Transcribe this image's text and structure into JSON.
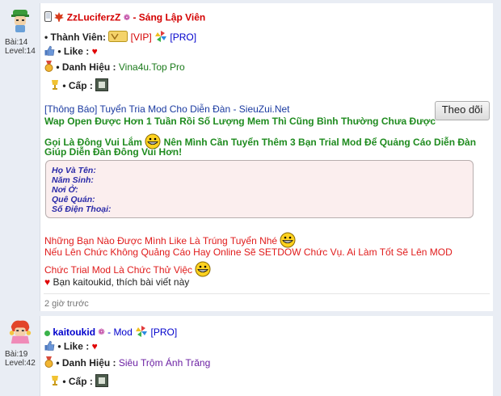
{
  "post1": {
    "username": "ZzLuciferzZ",
    "role": "Sáng Lập Viên",
    "posts_label": "Bài:14",
    "level_label": "Level:14",
    "member_label": "• Thành Viên:",
    "vip_label": "[VIP]",
    "pro_label": "[PRO]",
    "like_label": "• Like :",
    "title_label": "• Danh Hiệu :",
    "title_value": "Vina4u.Top Pro",
    "rank_label": "• Cấp :",
    "follow_button": "Theo dõi",
    "news_link": "[Thông Báo] Tuyển Tria Mod Cho Diễn Đàn - SieuZui.Net",
    "green_line1": "Wap Open Được Hơn 1 Tuần Rồi Số Lượng Mem Thì Cũng Bình Thường Chưa Được",
    "green_line2a": "Gọi Là Đông Vui Lắm",
    "green_line2b": "Nên Mình Cần Tuyển Thêm 3 Bạn Trial Mod Để Quảng Cáo Diễn Đàn",
    "green_line3": "Giúp Diễn Đàn Đông Vui Hơn!",
    "form_fields": [
      "Họ Và Tên:",
      "Năm Sinh:",
      "Nơi Ở:",
      "Quê Quán:",
      "Số Điện Thoại:"
    ],
    "red_line1": "Những Bạn Nào Được Mình Like Là Trúng Tuyển Nhé",
    "red_line2": "Nếu Lên Chức Không Quảng Cáo Hay Online Sẽ SETDOW Chức Vụ. Ai Làm Tốt Sẽ Lên MOD",
    "red_line3": "Chức Trial Mod Là Chức Thử Việc",
    "liked_by": "Bạn kaitoukid, thích bài viết này",
    "time": "2 giờ trước"
  },
  "post2": {
    "username": "kaitoukid",
    "role": "- Mod",
    "pro_label": "[PRO]",
    "posts_label": "Bài:19",
    "level_label": "Level:42",
    "like_label": "• Like :",
    "title_label": "• Danh Hiệu :",
    "title_value": "Siêu Trộm Ánh Trăng",
    "rank_label": "• Cấp :"
  },
  "colors": {
    "username": "#d40000",
    "link_blue": "#1a3aa0",
    "green": "#1f8b1f",
    "red": "#e01b1b",
    "purple": "#6b1fa3"
  }
}
